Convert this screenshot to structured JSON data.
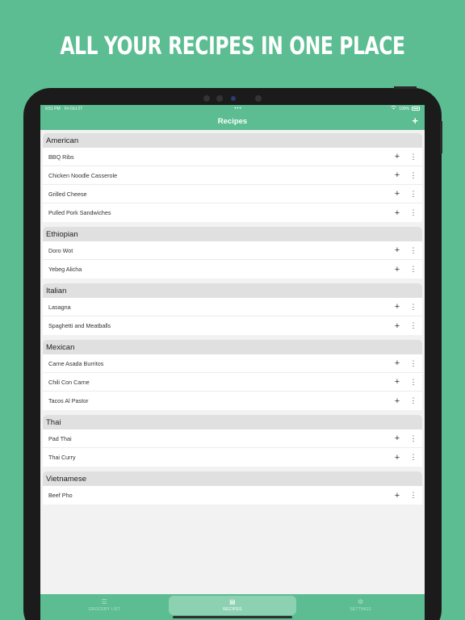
{
  "headline": "ALL YOUR RECIPES IN ONE PLACE",
  "status_bar": {
    "time": "9:51 PM",
    "date": "Fri Oct 27",
    "dots": "•••",
    "battery_pct": "100%"
  },
  "nav": {
    "title": "Recipes",
    "add_icon": "+"
  },
  "sections": [
    {
      "name": "American",
      "recipes": [
        "BBQ Ribs",
        "Chicken Noodle Casserole",
        "Grilled Cheese",
        "Pulled Pork Sandwiches"
      ]
    },
    {
      "name": "Ethiopian",
      "recipes": [
        "Doro Wot",
        "Yebeg Alicha"
      ]
    },
    {
      "name": "Italian",
      "recipes": [
        "Lasagna",
        "Spaghetti and Meatballs"
      ]
    },
    {
      "name": "Mexican",
      "recipes": [
        "Carne Asada Burritos",
        "Chili Con Carne",
        "Tacos Al Pastor"
      ]
    },
    {
      "name": "Thai",
      "recipes": [
        "Pad Thai",
        "Thai Curry"
      ]
    },
    {
      "name": "Vietnamese",
      "recipes": [
        "Beef Pho"
      ]
    }
  ],
  "row_icons": {
    "add": "+",
    "more": "⋮"
  },
  "tabs": [
    {
      "label": "GROCERY LIST",
      "icon": "list-icon",
      "glyph": "☰",
      "active": false
    },
    {
      "label": "RECIPES",
      "icon": "book-icon",
      "glyph": "▤",
      "active": true
    },
    {
      "label": "SETTINGS",
      "icon": "gear-icon",
      "glyph": "⚙",
      "active": false
    }
  ],
  "colors": {
    "brand_green": "#5bbd91",
    "section_bg": "#e0e0e0",
    "list_bg": "#f2f2f2"
  }
}
